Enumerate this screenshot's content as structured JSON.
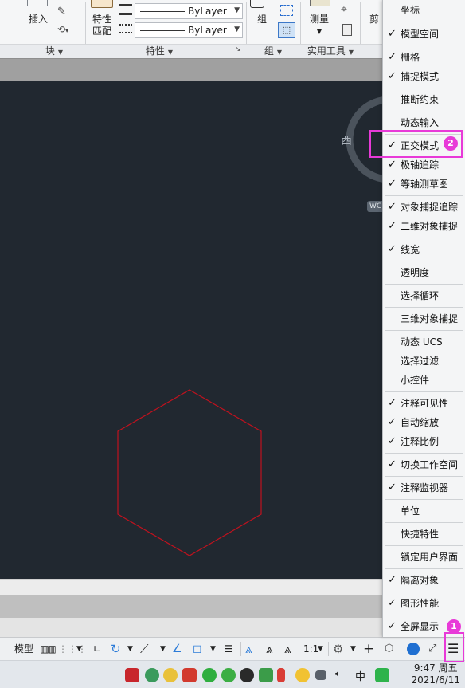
{
  "ribbon": {
    "insert_label": "插入",
    "match_props_label_line1": "特性",
    "match_props_label_line2": "匹配",
    "layer_combo_1": "ByLayer",
    "layer_combo_2": "ByLayer",
    "group_label": "组",
    "measure_label": "测量",
    "clipboard_label": "剪",
    "panels": {
      "block": "块",
      "properties": "特性",
      "group": "组",
      "utilities": "实用工具"
    }
  },
  "canvas": {
    "compass_west": "西",
    "wcs_label": "WC",
    "background_color": "#212830",
    "shape_color": "#c0121e"
  },
  "statusbar": {
    "model_label": "模型",
    "annotation_scale": "1:1"
  },
  "taskbar": {
    "ime_label": "中",
    "time": "9:47 周五",
    "date": "2021/6/11"
  },
  "menu": {
    "items": [
      {
        "label": "坐标",
        "check": ""
      },
      {
        "label": "模型空间",
        "check": "✓"
      },
      {
        "label": "栅格",
        "check": "✓"
      },
      {
        "label": "捕捉模式",
        "check": "✓"
      },
      {
        "label": "推断约束",
        "check": ""
      },
      {
        "label": "动态输入",
        "check": ""
      },
      {
        "label": "正交模式",
        "check": "✓"
      },
      {
        "label": "极轴追踪",
        "check": "✓"
      },
      {
        "label": "等轴测草图",
        "check": "✓"
      },
      {
        "label": "对象捕捉追踪",
        "check": "✓"
      },
      {
        "label": "二维对象捕捉",
        "check": "✓"
      },
      {
        "label": "线宽",
        "check": "✓"
      },
      {
        "label": "透明度",
        "check": ""
      },
      {
        "label": "选择循环",
        "check": ""
      },
      {
        "label": "三维对象捕捉",
        "check": ""
      },
      {
        "label": "动态 UCS",
        "check": ""
      },
      {
        "label": "选择过滤",
        "check": ""
      },
      {
        "label": "小控件",
        "check": ""
      },
      {
        "label": "注释可见性",
        "check": "✓"
      },
      {
        "label": "自动缩放",
        "check": "✓"
      },
      {
        "label": "注释比例",
        "check": "✓"
      },
      {
        "label": "切换工作空间",
        "check": "✓"
      },
      {
        "label": "注释监视器",
        "check": "✓"
      },
      {
        "label": "单位",
        "check": ""
      },
      {
        "label": "快捷特性",
        "check": ""
      },
      {
        "label": "锁定用户界面",
        "check": ""
      },
      {
        "label": "隔离对象",
        "check": "✓"
      },
      {
        "label": "图形性能",
        "check": "✓"
      },
      {
        "label": "全屏显示",
        "check": "✓"
      }
    ]
  },
  "annotations": {
    "badge_1": "1",
    "badge_2": "2",
    "highlight_color": "#e83ad8"
  }
}
